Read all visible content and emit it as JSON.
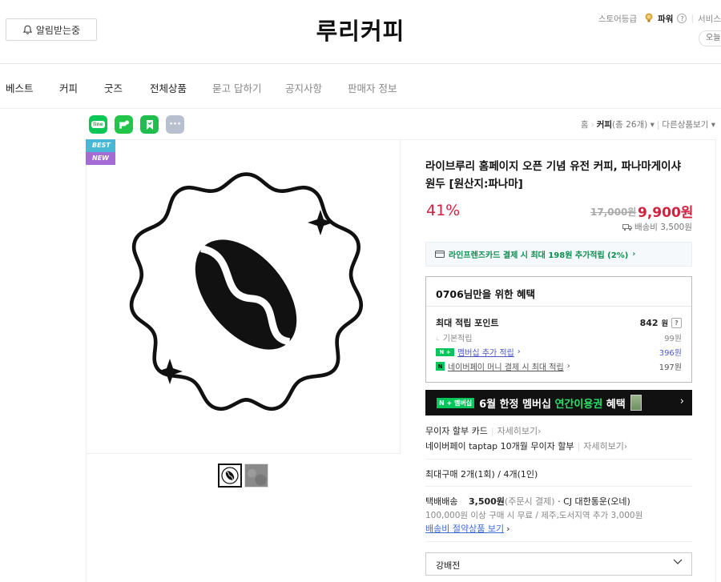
{
  "header": {
    "notify_label": "알림받는중",
    "store_title": "루리커피",
    "store_grade_label": "스토어등급",
    "grade_value": "파워",
    "grade_help": "?",
    "service_label": "서비스",
    "today_label": "오늘"
  },
  "nav": {
    "items": [
      {
        "label": "베스트"
      },
      {
        "label": "커피"
      },
      {
        "label": "굿즈"
      },
      {
        "label": "전체상품"
      },
      {
        "label": "묻고 답하기"
      },
      {
        "label": "공지사항"
      },
      {
        "label": "판매자 정보"
      }
    ]
  },
  "share": {
    "icons": [
      "line-icon",
      "band-icon",
      "bookmark-icon",
      "more-icon"
    ],
    "line_text": "line",
    "more_text": "···"
  },
  "breadcrumb": {
    "home": "홈",
    "category": "커피",
    "count": "(총 26개)",
    "other": "다른상품보기"
  },
  "badges": {
    "best": "BEST",
    "new": "NEW"
  },
  "product": {
    "title": "라이브루리 홈페이지 오픈 기념 유전 커피, 파나마게이샤원두 [원산지:파나마]",
    "discount": "41%",
    "original_price": "17,000원",
    "sale_price": "9,900원",
    "shipping_fee": "배송비 3,500원"
  },
  "card_benefit": {
    "text": "라인프렌즈카드 결제 시 최대 198원 추가적립 (2%)",
    "arrow": "›"
  },
  "benefit": {
    "title": "0706님만을 위한 혜택",
    "max_label": "최대 적립 포인트",
    "max_value": "842",
    "max_unit": "원",
    "help": "?",
    "basic_label": "기본적립",
    "basic_value": "99원",
    "member_tag": "N +",
    "member_label": "멤버십 추가 적립",
    "member_arrow": "›",
    "member_value": "396원",
    "npay_tag": "N",
    "npay_label": "네이버페이 머니 결제 시 최대 적립",
    "npay_arrow": "›",
    "npay_value": "197원"
  },
  "banner": {
    "tag": "N + 멤버십",
    "text_a": "6월 한정 멤버십 ",
    "text_b": "연간이용권",
    "text_c": " 혜택",
    "arrow": "›"
  },
  "installment": {
    "label_a": "무이자 할부 카드",
    "more_a": "자세히보기",
    "arrow_a": "›",
    "label_b": "네이버페이 taptap 10개월 무이자 할부",
    "more_b": "자세히보기",
    "arrow_b": "›"
  },
  "purchase_limit": "최대구매 2개(1회) / 4개(1인)",
  "delivery": {
    "type": "택배배송",
    "fee": "3,500원",
    "fee_note": "(주문시 결제)",
    "carrier": "· CJ 대한통운(오네)",
    "condition": "100,000원 이상 구매 시 무료 / 제주,도서지역 추가 3,000원",
    "link": "배송비 절약상품 보기",
    "link_arrow": "›"
  },
  "option": {
    "selected": "강배전"
  },
  "colors": {
    "accent_red": "#d3203e",
    "naver_green": "#03c75a",
    "member_blue": "#5459c9"
  }
}
